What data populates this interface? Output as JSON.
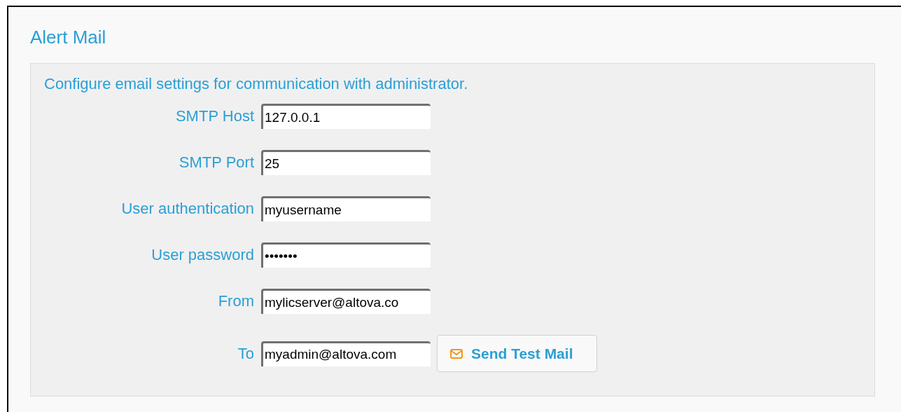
{
  "section": {
    "title": "Alert Mail"
  },
  "panel": {
    "description": "Configure email settings for communication with administrator.",
    "fields": [
      {
        "label": "SMTP Host",
        "value": "127.0.0.1"
      },
      {
        "label": "SMTP Port",
        "value": "25"
      },
      {
        "label": "User authentication",
        "value": "myusername"
      },
      {
        "label": "User password",
        "value": "•••••••"
      },
      {
        "label": "From",
        "value": "mylicserver@altova.co"
      },
      {
        "label": "To",
        "value": "myadmin@altova.com"
      }
    ],
    "button": {
      "label": "Send Test Mail"
    }
  }
}
